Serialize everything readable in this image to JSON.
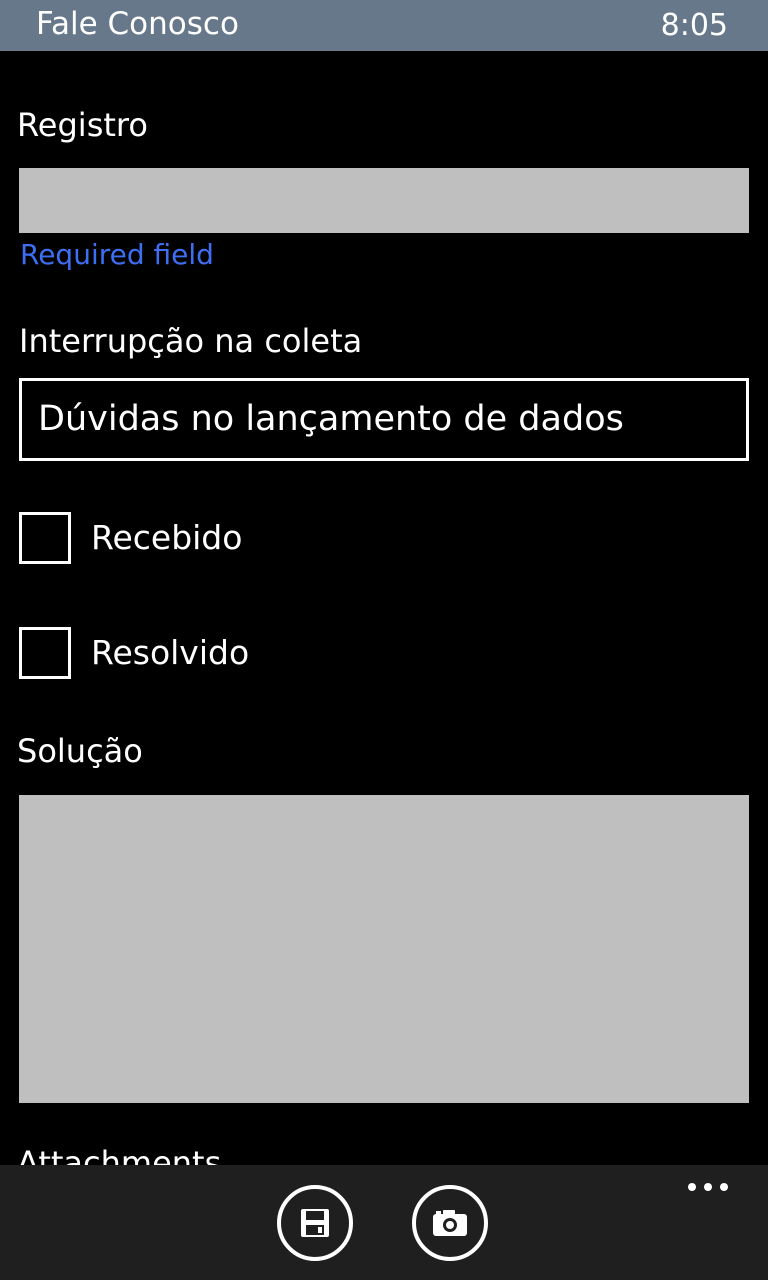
{
  "status_bar": {
    "app_title": "Fale Conosco",
    "time": "8:05"
  },
  "form": {
    "registro": {
      "label": "Registro",
      "value": "",
      "validation": "Required field"
    },
    "interrupcao": {
      "label": "Interrupção na coleta",
      "selected": "Dúvidas no lançamento de dados"
    },
    "checkboxes": [
      {
        "label": "Recebido",
        "checked": false
      },
      {
        "label": "Resolvido",
        "checked": false
      }
    ],
    "solucao": {
      "label": "Solução",
      "value": ""
    },
    "attachments": {
      "label": "Attachments"
    }
  },
  "app_bar": {
    "buttons": [
      "save-icon",
      "camera-icon"
    ],
    "more": "ellipsis-icon"
  },
  "colors": {
    "status_bar_bg": "#66788a",
    "textbox_bg": "#bfbfbf",
    "validation_text": "#3d6ff5",
    "app_bar_bg": "#1f1f1f"
  }
}
